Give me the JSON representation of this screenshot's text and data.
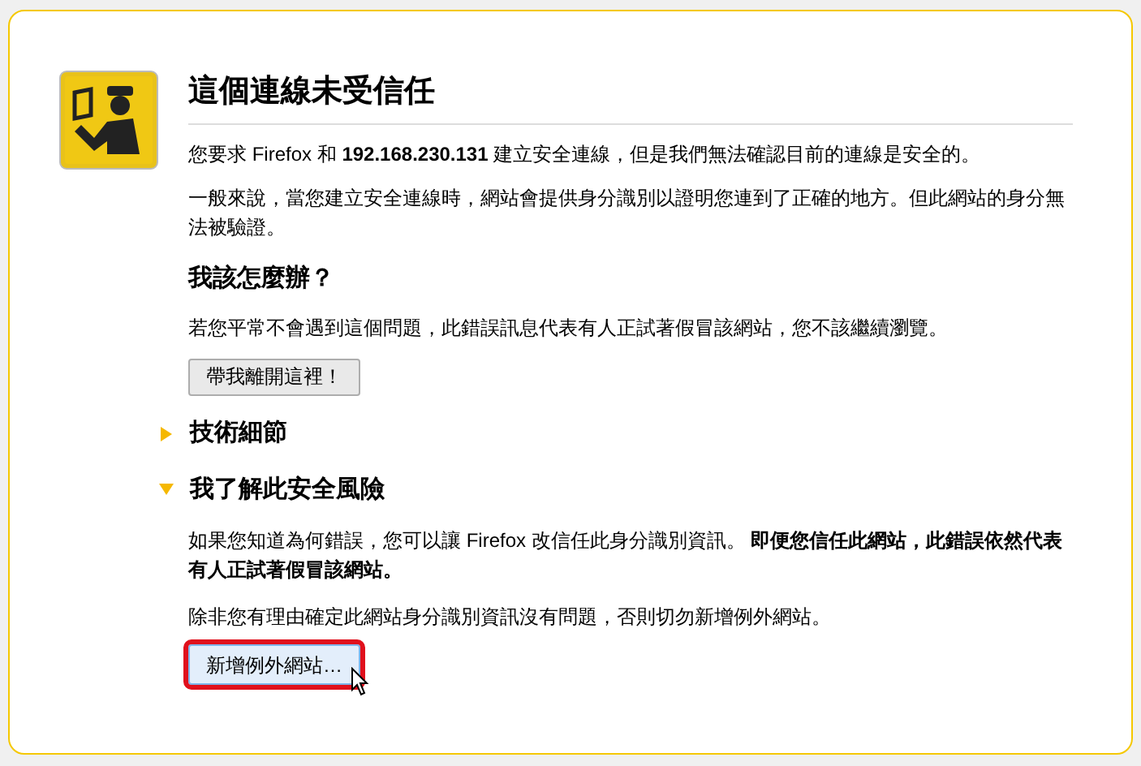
{
  "title": "這個連線未受信任",
  "paragraphs": [
    "您要求 Firefox 和 **192.168.230.131** 建立安全連線，但是我們無法確認目前的連線是安全的。",
    "一般來說，當您建立安全連線時，網站會提供身分識別以證明您連到了正確的地方。但此網站的身分無法被驗證。"
  ],
  "what_to_do": {
    "heading": "我該怎麼辦？",
    "text": "若您平常不會遇到這個問題，此錯誤訊息代表有人正試著假冒該網站，您不該繼續瀏覽。",
    "button": "帶我離開這裡！"
  },
  "expanders": [
    {
      "label": "技術細節",
      "expanded": false
    },
    {
      "label": "我了解此安全風險",
      "expanded": true,
      "paragraphs": [
        "如果您知道為何錯誤，您可以讓 Firefox 改信任此身分識別資訊。 **即便您信任此網站，此錯誤依然代表有人正試著假冒該網站。**",
        "除非您有理由確定此網站身分識別資訊沒有問題，否則切勿新增例外網站。"
      ],
      "button": {
        "label": "新增例外網站…",
        "highlighted": true
      }
    }
  ]
}
